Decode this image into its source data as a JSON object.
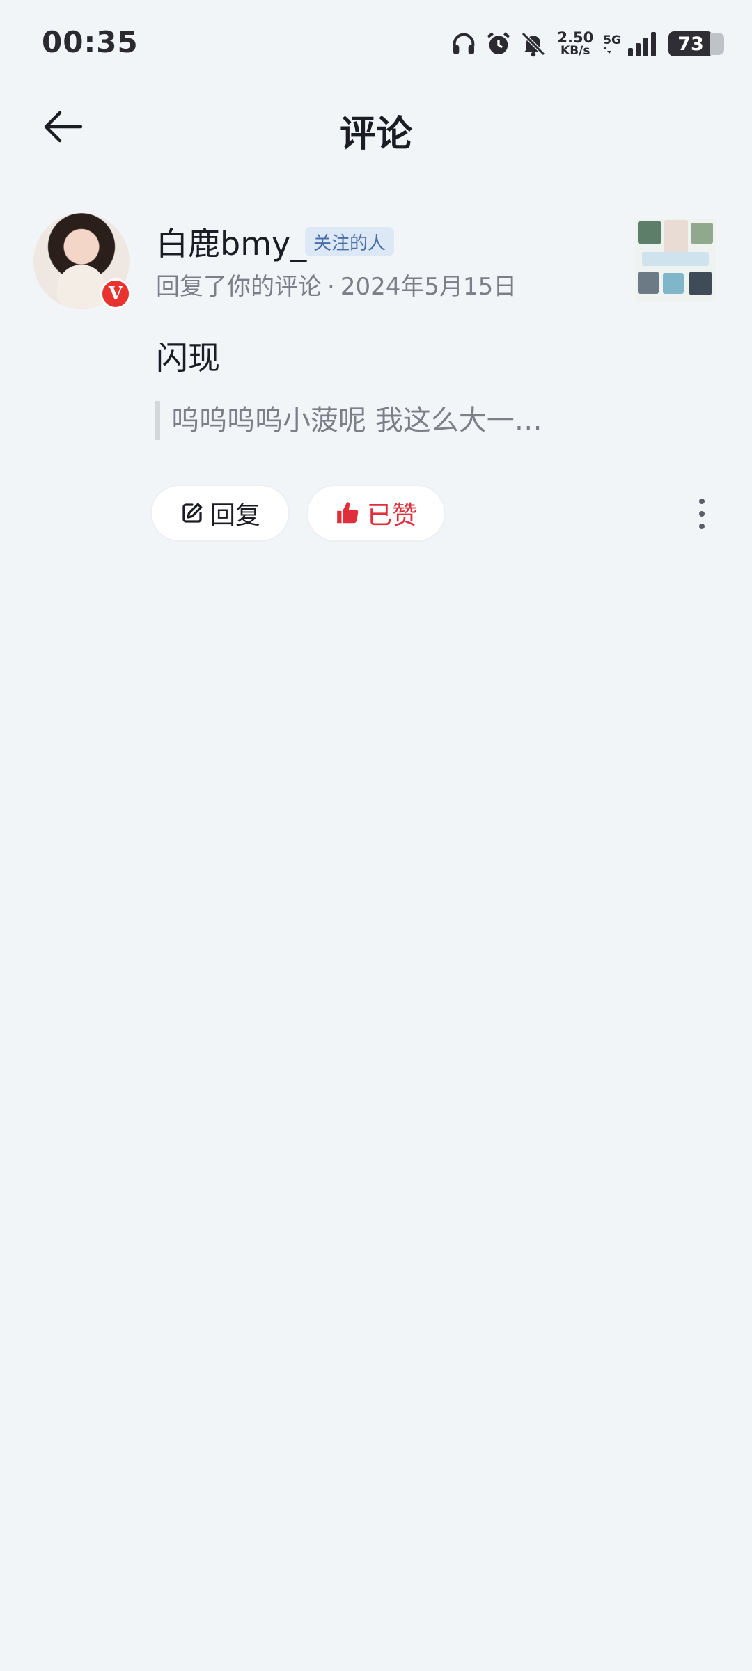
{
  "status": {
    "time": "00:35",
    "speed_value": "2.50",
    "speed_unit": "KB/s",
    "network": "5G",
    "battery": "73",
    "icons": [
      "headphones-icon",
      "alarm-icon",
      "mute-bell-icon",
      "signal-icon"
    ]
  },
  "header": {
    "title": "评论",
    "back_icon": "arrow-left-icon"
  },
  "notification": {
    "username": "白鹿bmy_",
    "tag": "关注的人",
    "verified_badge": "V",
    "action": "回复了你的评论",
    "separator": "·",
    "date": "2024年5月15日",
    "comment": "闪现",
    "quoted": "呜呜呜呜小菠呢 我这么大一…",
    "reply_label": "回复",
    "like_label": "已赞",
    "colors": {
      "liked": "#e02e3b",
      "tag_bg": "#dde8f6",
      "tag_text": "#4a6fa8",
      "verified": "#e8332e"
    }
  }
}
